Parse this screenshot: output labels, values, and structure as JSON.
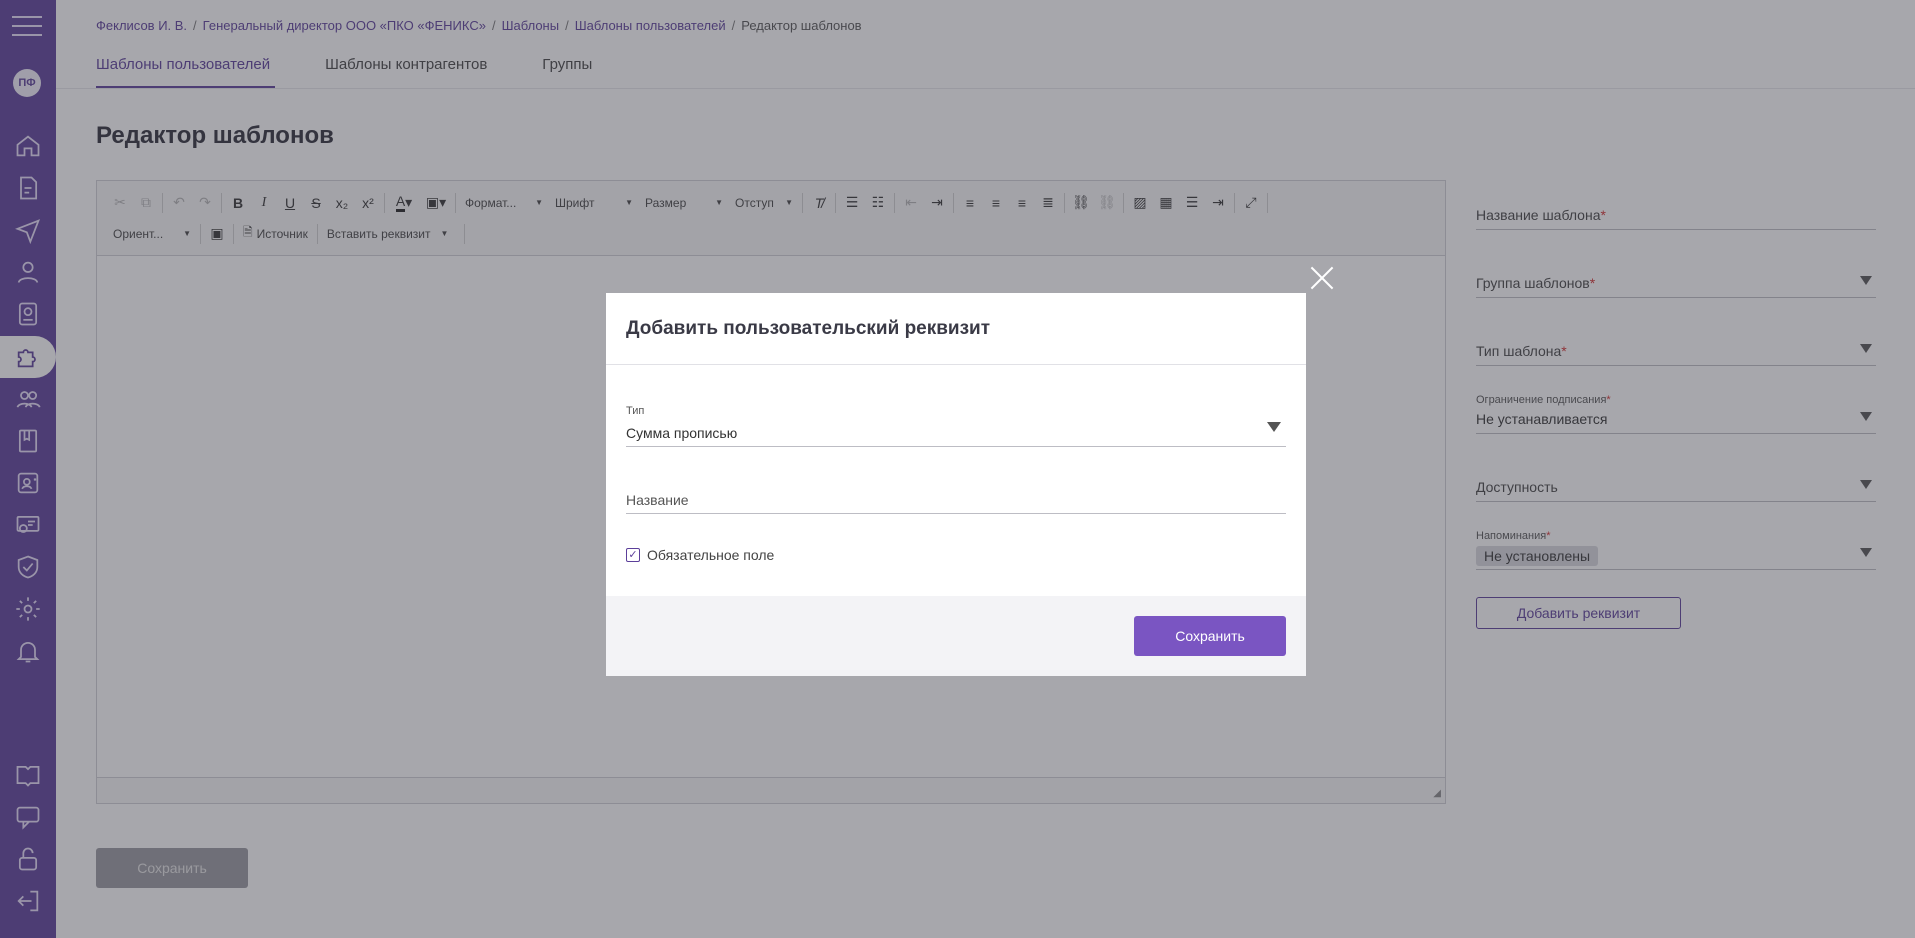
{
  "sidebar": {
    "avatar_initials": "ПФ",
    "icons": [
      "menu-icon",
      "home-icon",
      "document-icon",
      "send-icon",
      "user-icon",
      "badge-icon",
      "puzzle-icon",
      "group-icon",
      "book-icon",
      "contact-icon",
      "certificate-icon",
      "shield-icon",
      "settings-icon",
      "bell-icon",
      "help-book-icon",
      "chat-icon",
      "lock-icon",
      "logout-icon"
    ]
  },
  "breadcrumb": {
    "items": [
      "Феклисов И. В.",
      "Генеральный директор ООО «ПКО «ФЕНИКС»",
      "Шаблоны",
      "Шаблоны пользователей"
    ],
    "current": "Редактор шаблонов",
    "separator": "/"
  },
  "tabs": [
    {
      "label": "Шаблоны пользователей",
      "active": true
    },
    {
      "label": "Шаблоны контрагентов",
      "active": false
    },
    {
      "label": "Группы",
      "active": false
    }
  ],
  "page_title": "Редактор шаблонов",
  "editor": {
    "format_combo": "Формат...",
    "font_combo": "Шрифт",
    "size_combo": "Размер",
    "indent_combo": "Отступ",
    "orient_combo": "Ориент...",
    "source_label": "Источник",
    "insert_req_combo": "Вставить реквизит"
  },
  "bottom_save": "Сохранить",
  "right_form": {
    "template_name_label": "Название шаблона",
    "template_group_label": "Группа шаблонов",
    "template_type_label": "Тип шаблона",
    "sign_limit_label": "Ограничение подписания",
    "sign_limit_value": "Не устанавливается",
    "availability_label": "Доступность",
    "reminders_label": "Напоминания",
    "reminders_value": "Не установлены",
    "add_req_button": "Добавить реквизит",
    "required_mark": "*"
  },
  "modal": {
    "title": "Добавить пользовательский реквизит",
    "type_label": "Тип",
    "type_value": "Сумма прописью",
    "name_placeholder": "Название",
    "required_checkbox_label": "Обязательное поле",
    "required_checked": true,
    "save_button": "Сохранить"
  },
  "colors": {
    "brand": "#5c3f9a",
    "modal_save": "#7a55c2",
    "required": "#d32f2f"
  }
}
